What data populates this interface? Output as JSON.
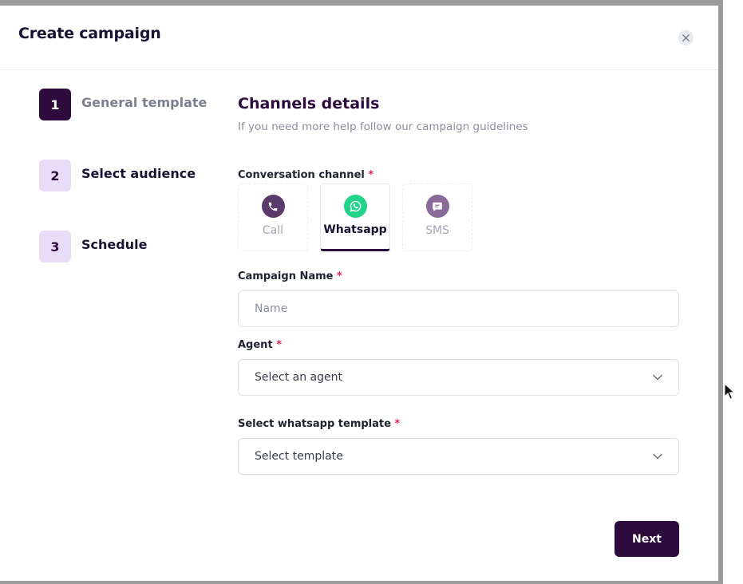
{
  "modal": {
    "title": "Create campaign"
  },
  "steps": [
    {
      "number": "1",
      "label": "General template",
      "state": "active"
    },
    {
      "number": "2",
      "label": "Select audience",
      "state": "inactive"
    },
    {
      "number": "3",
      "label": "Schedule",
      "state": "inactive"
    }
  ],
  "section": {
    "title": "Channels details",
    "subtitle": "If you need more help follow our campaign guidelines"
  },
  "conversation_channel": {
    "label": "Conversation channel",
    "required_mark": "*",
    "options": [
      {
        "label": "Call",
        "icon": "phone-icon",
        "selected": false
      },
      {
        "label": "Whatsapp",
        "icon": "whatsapp-icon",
        "selected": true
      },
      {
        "label": "SMS",
        "icon": "message-icon",
        "selected": false
      }
    ]
  },
  "campaign_name": {
    "label": "Campaign Name",
    "required_mark": "*",
    "placeholder": "Name",
    "value": ""
  },
  "agent": {
    "label": "Agent",
    "required_mark": "*",
    "value": "Select an agent"
  },
  "template": {
    "label": "Select whatsapp template",
    "required_mark": "*",
    "value": "Select template"
  },
  "footer": {
    "next_label": "Next"
  },
  "colors": {
    "primary": "#2d0b3d",
    "step_inactive_bg": "#e8dcf7",
    "required": "#e02451",
    "whatsapp": "#20d58a",
    "call_icon_bg": "#5b3b6c",
    "sms_icon_bg": "#8a6a98"
  }
}
